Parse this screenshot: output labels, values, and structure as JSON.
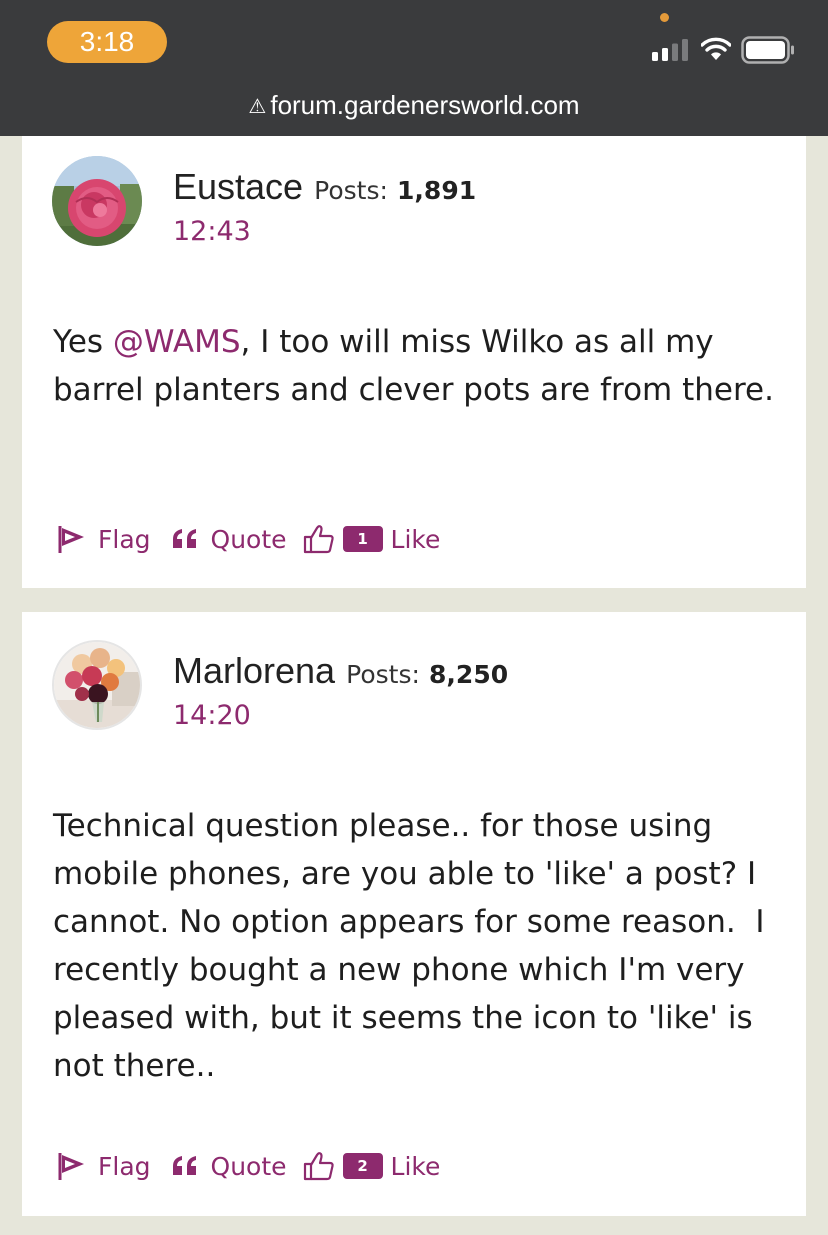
{
  "status_bar": {
    "time": "3:18",
    "url": "forum.gardenersworld.com",
    "icons": [
      "warning-icon",
      "signal-icon",
      "wifi-icon",
      "battery-icon"
    ]
  },
  "posts": [
    {
      "author": "Eustace",
      "posts_label": "Posts:",
      "posts_count": "1,891",
      "time": "12:43",
      "body_prefix": "Yes ",
      "mention": "@WAMS",
      "body_suffix": ", I too will miss Wilko as all my barrel planters and clever pots are from there.",
      "actions": {
        "flag": "Flag",
        "quote": "Quote",
        "like_count": "1",
        "like": "Like"
      }
    },
    {
      "author": "Marlorena",
      "posts_label": "Posts:",
      "posts_count": "8,250",
      "time": "14:20",
      "body": "Technical question please.. for those using mobile phones, are you able to 'like' a post? I cannot. No option appears for some reason.  I recently bought a new phone which I'm very pleased with, but it seems the icon to 'like' is not there..",
      "actions": {
        "flag": "Flag",
        "quote": "Quote",
        "like_count": "2",
        "like": "Like"
      }
    }
  ],
  "colors": {
    "accent": "#8d2a6e",
    "status_bar_bg": "#3a3b3d",
    "time_pill": "#eea539",
    "page_bg": "#e6e6da"
  }
}
